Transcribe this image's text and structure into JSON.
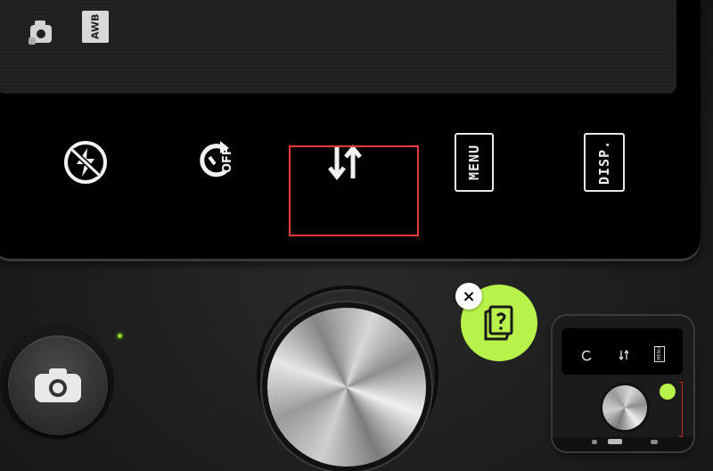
{
  "viewfinder": {
    "mode_icon": "camera-mode-icon",
    "awb_label": "AWB"
  },
  "controls": [
    {
      "name": "flash-off",
      "icon": "flash-off-icon"
    },
    {
      "name": "timer-off",
      "icon": "self-timer-off-icon",
      "label": "OFF"
    },
    {
      "name": "flip-camera",
      "icon": "swap-vertical-icon"
    },
    {
      "name": "menu",
      "label": "MENU"
    },
    {
      "name": "display",
      "label": "DISP."
    }
  ],
  "mini_preview": {
    "menu_label": "MENU"
  },
  "colors": {
    "highlight": "#e53935",
    "accent_green": "#b8f24a",
    "led": "#8fdd2a"
  }
}
